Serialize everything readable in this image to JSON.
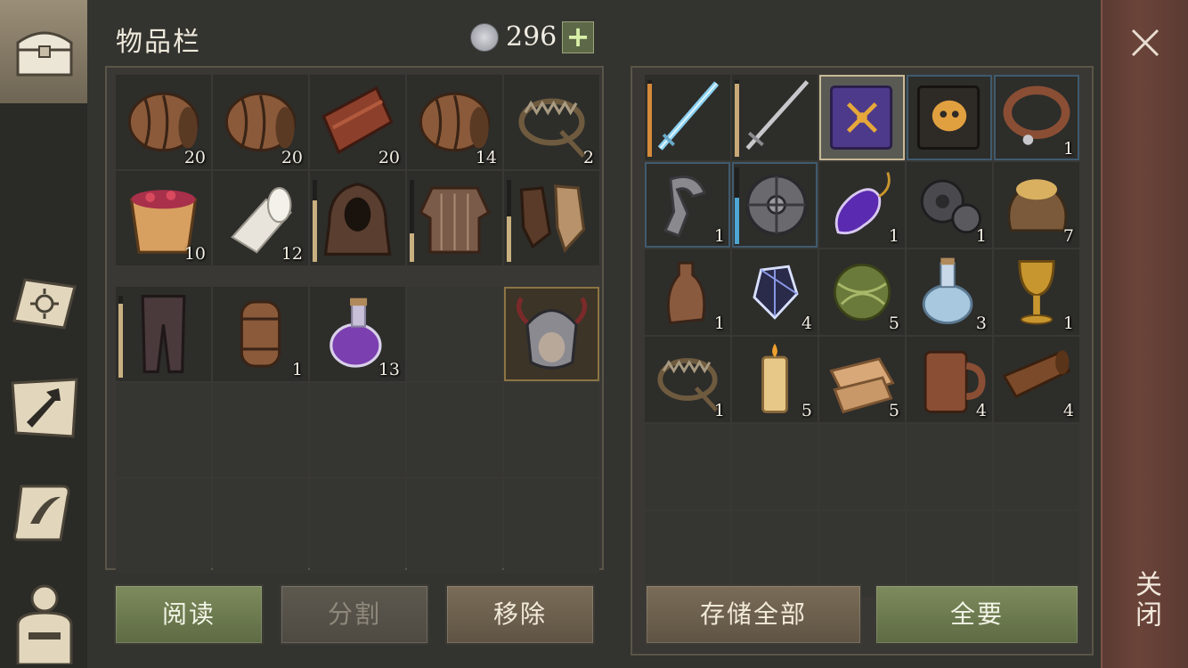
{
  "header": {
    "title": "物品栏",
    "currency_count": "296",
    "add_label": "+"
  },
  "sidebar": {
    "tabs": [
      "inventory",
      "skills",
      "crafting",
      "quests",
      "character"
    ]
  },
  "inventory": {
    "items": [
      {
        "icon": "barrel-icon",
        "count": "20"
      },
      {
        "icon": "barrel-icon",
        "count": "20"
      },
      {
        "icon": "leather-strips-icon",
        "count": "20"
      },
      {
        "icon": "barrel-icon",
        "count": "14"
      },
      {
        "icon": "bear-trap-icon",
        "count": "2"
      },
      {
        "icon": "berry-bucket-icon",
        "count": "10"
      },
      {
        "icon": "bandage-roll-icon",
        "count": "12"
      },
      {
        "icon": "hood-icon",
        "count": "",
        "durability": 0.75
      },
      {
        "icon": "chainmail-icon",
        "count": "",
        "durability": 0.35
      },
      {
        "icon": "gloves-icon",
        "count": "",
        "durability": 0.55
      },
      {
        "icon": "leggings-icon",
        "count": "",
        "durability": 0.9
      },
      {
        "icon": "small-barrel-icon",
        "count": "1"
      },
      {
        "icon": "purple-potion-icon",
        "count": "13"
      },
      {
        "icon": "",
        "count": ""
      },
      {
        "icon": "horned-helmet-head-icon",
        "count": "",
        "highlighted": true
      }
    ]
  },
  "storage": {
    "items": [
      {
        "icon": "ice-sword-icon",
        "count": "",
        "durability": 0.95,
        "bar_color": "#d58a3a"
      },
      {
        "icon": "longsword-icon",
        "count": "",
        "durability": 0.95,
        "bar_color": "#c9a978"
      },
      {
        "icon": "purple-tome-icon",
        "count": "",
        "selected": true
      },
      {
        "icon": "skull-tome-icon",
        "count": ""
      },
      {
        "icon": "leather-collar-icon",
        "count": "1"
      },
      {
        "icon": "iron-clamp-icon",
        "count": "1"
      },
      {
        "icon": "round-shield-icon",
        "count": "",
        "durability": 0.6,
        "bar_color": "#4fa6d2"
      },
      {
        "icon": "amulet-potion-icon",
        "count": "1"
      },
      {
        "icon": "gear-parts-icon",
        "count": "1"
      },
      {
        "icon": "grain-sack-icon",
        "count": "7"
      },
      {
        "icon": "clay-bottle-icon",
        "count": "1"
      },
      {
        "icon": "crystal-shard-icon",
        "count": "4"
      },
      {
        "icon": "twine-ball-icon",
        "count": "5"
      },
      {
        "icon": "water-flask-icon",
        "count": "3"
      },
      {
        "icon": "golden-goblet-icon",
        "count": "1"
      },
      {
        "icon": "bear-trap-icon",
        "count": "1"
      },
      {
        "icon": "candle-icon",
        "count": "5"
      },
      {
        "icon": "folded-cloth-icon",
        "count": "5"
      },
      {
        "icon": "wooden-mug-icon",
        "count": "4"
      },
      {
        "icon": "leather-roll-icon",
        "count": "4"
      }
    ]
  },
  "buttons": {
    "read": "阅读",
    "split": "分割",
    "remove": "移除",
    "store_all": "存储全部",
    "take_all": "全要"
  },
  "close": {
    "label": "关闭"
  }
}
